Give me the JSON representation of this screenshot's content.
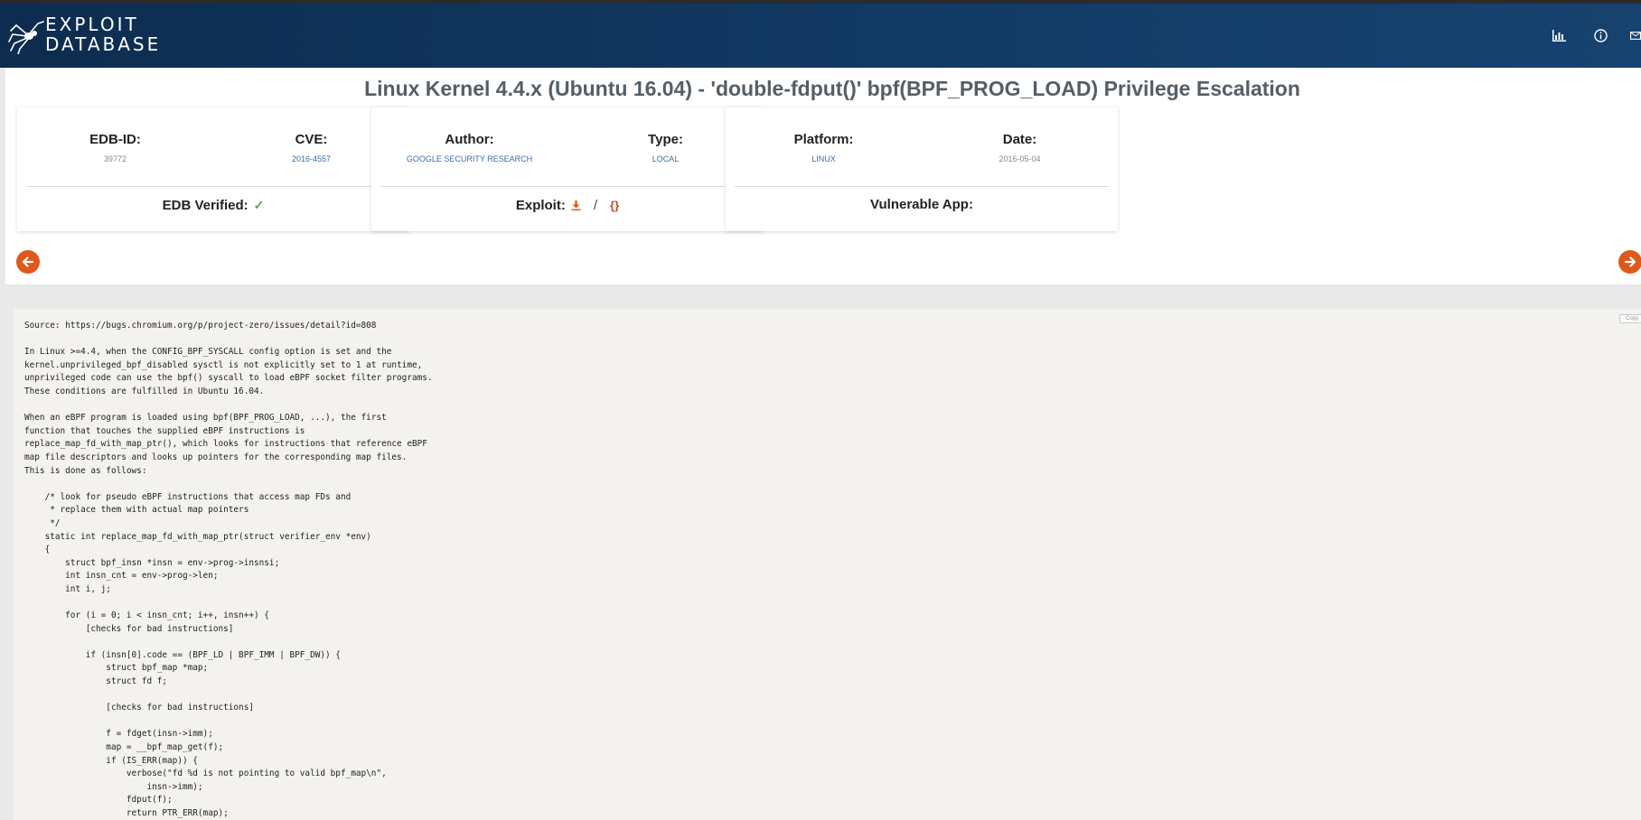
{
  "header": {
    "logo_line1": "EXPLOIT",
    "logo_line2": "DATABASE",
    "icons": [
      "bar-chart-icon",
      "info-icon",
      "envelope-icon"
    ]
  },
  "exploit": {
    "title": "Linux Kernel 4.4.x (Ubuntu 16.04) - 'double-fdput()' bpf(BPF_PROG_LOAD) Privilege Escalation",
    "edb_id_label": "EDB-ID:",
    "edb_id": "39772",
    "cve_label": "CVE:",
    "cve": "2016-4557",
    "author_label": "Author:",
    "author": "GOOGLE SECURITY RESEARCH",
    "type_label": "Type:",
    "type": "LOCAL",
    "platform_label": "Platform:",
    "platform": "LINUX",
    "date_label": "Date:",
    "date": "2016-05-04",
    "verified_label": "EDB Verified:",
    "exploit_label": "Exploit:",
    "vulnerable_app_label": "Vulnerable App:"
  },
  "code": {
    "copy_label": "Copy",
    "text": "Source: https://bugs.chromium.org/p/project-zero/issues/detail?id=808\n\nIn Linux >=4.4, when the CONFIG_BPF_SYSCALL config option is set and the\nkernel.unprivileged_bpf_disabled sysctl is not explicitly set to 1 at runtime,\nunprivileged code can use the bpf() syscall to load eBPF socket filter programs.\nThese conditions are fulfilled in Ubuntu 16.04.\n\nWhen an eBPF program is loaded using bpf(BPF_PROG_LOAD, ...), the first\nfunction that touches the supplied eBPF instructions is\nreplace_map_fd_with_map_ptr(), which looks for instructions that reference eBPF\nmap file descriptors and looks up pointers for the corresponding map files.\nThis is done as follows:\n\n    /* look for pseudo eBPF instructions that access map FDs and\n     * replace them with actual map pointers\n     */\n    static int replace_map_fd_with_map_ptr(struct verifier_env *env)\n    {\n        struct bpf_insn *insn = env->prog->insnsi;\n        int insn_cnt = env->prog->len;\n        int i, j;\n\n        for (i = 0; i < insn_cnt; i++, insn++) {\n            [checks for bad instructions]\n\n            if (insn[0].code == (BPF_LD | BPF_IMM | BPF_DW)) {\n                struct bpf_map *map;\n                struct fd f;\n\n                [checks for bad instructions]\n\n                f = fdget(insn->imm);\n                map = __bpf_map_get(f);\n                if (IS_ERR(map)) {\n                    verbose(\"fd %d is not pointing to valid bpf_map\\n\",\n                        insn->imm);\n                    fdput(f);\n                    return PTR_ERR(map);"
  }
}
